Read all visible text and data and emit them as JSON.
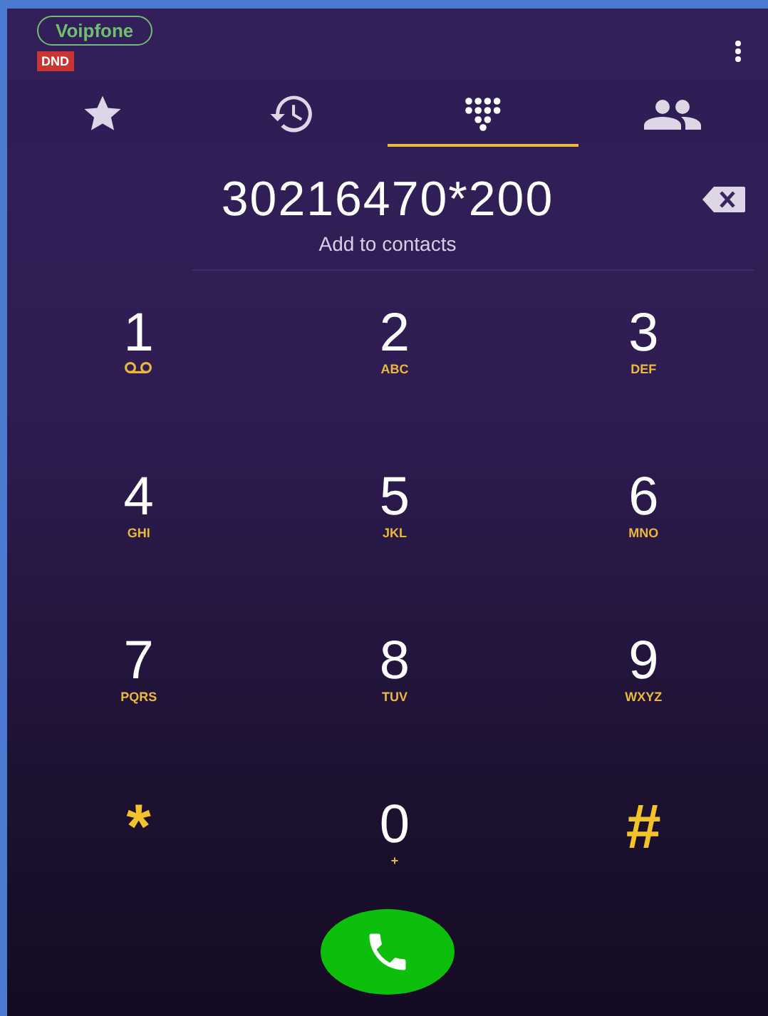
{
  "header": {
    "account": "Voipfone",
    "status_badge": "DND"
  },
  "tabs": [
    {
      "kind": "favorites",
      "selected": false
    },
    {
      "kind": "recents",
      "selected": false
    },
    {
      "kind": "dialpad",
      "selected": true
    },
    {
      "kind": "contacts",
      "selected": false
    }
  ],
  "number": "30216470*200",
  "add_to_contacts": "Add to contacts",
  "keys": [
    {
      "kind": "voicemail",
      "main": "1"
    },
    {
      "kind": "digit",
      "main": "2",
      "sub": "ABC"
    },
    {
      "kind": "digit",
      "main": "3",
      "sub": "DEF"
    },
    {
      "kind": "digit",
      "main": "4",
      "sub": "GHI"
    },
    {
      "kind": "digit",
      "main": "5",
      "sub": "JKL"
    },
    {
      "kind": "digit",
      "main": "6",
      "sub": "MNO"
    },
    {
      "kind": "digit",
      "main": "7",
      "sub": "PQRS"
    },
    {
      "kind": "digit",
      "main": "8",
      "sub": "TUV"
    },
    {
      "kind": "digit",
      "main": "9",
      "sub": "WXYZ"
    },
    {
      "kind": "symbol",
      "main": "*"
    },
    {
      "kind": "digit",
      "main": "0",
      "sub": "+"
    },
    {
      "kind": "symbol",
      "main": "#"
    }
  ]
}
